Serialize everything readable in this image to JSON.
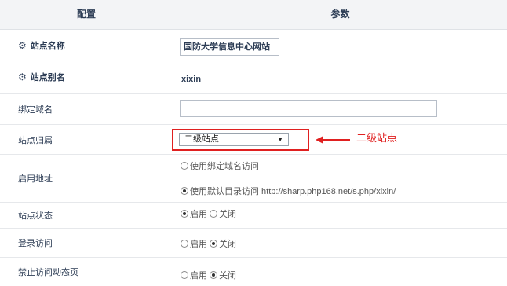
{
  "header": {
    "col_config": "配置",
    "col_params": "参数"
  },
  "rows": {
    "site_name": {
      "label": "站点名称",
      "value": "国防大学信息中心网站"
    },
    "site_alias": {
      "label": "站点别名",
      "value": "xixin"
    },
    "bind_domain": {
      "label": "绑定域名",
      "value": "",
      "placeholder": ""
    },
    "site_owner": {
      "label": "站点归属",
      "selected": "二级站点"
    },
    "enable_address": {
      "label": "启用地址",
      "opt1": "使用绑定域名访问",
      "opt2": "使用默认目录访问 http://sharp.php168.net/s.php/xixin/",
      "selected": "opt2"
    },
    "site_status": {
      "label": "站点状态",
      "on": "启用",
      "off": "关闭",
      "selected": "on"
    },
    "login_access": {
      "label": "登录访问",
      "on": "启用",
      "off": "关闭",
      "selected": "off"
    },
    "disable_dynamic": {
      "label": "禁止访问动态页",
      "on": "启用",
      "off": "关闭",
      "selected": "off"
    }
  },
  "annotation": {
    "text": "二级站点",
    "color": "#e02020"
  },
  "icons": {
    "row_icon": "gear-icon",
    "dropdown": "triangle-down-icon"
  }
}
